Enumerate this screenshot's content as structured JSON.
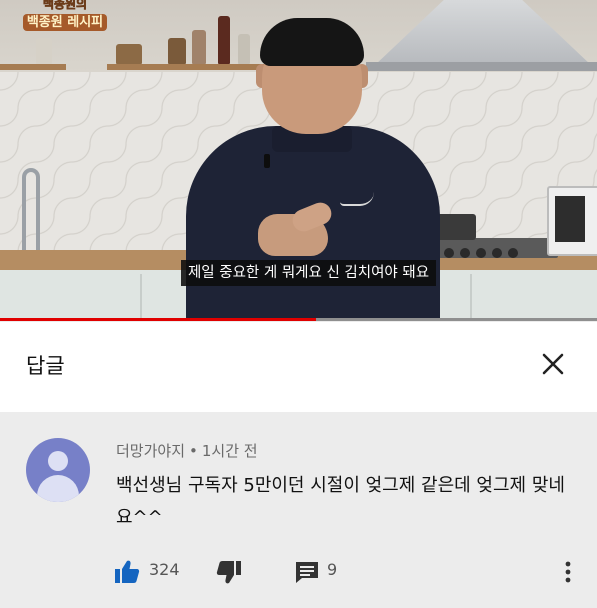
{
  "video": {
    "channel_logo_line1": "백종원의",
    "channel_logo_line2": "백종원 레시피",
    "subtitle": "제일 중요한 게 뭐게요 신 김치여야 돼요",
    "progress_fraction": 0.53
  },
  "replies_panel": {
    "title": "답글",
    "close_icon": "close-icon"
  },
  "comment": {
    "author": "더망가야지",
    "separator": "•",
    "time": "1시간 전",
    "text": "백선생님 구독자 5만이던 시절이 엊그제 같은데 엊그제 맞네요^^",
    "likes": "324",
    "replies": "9"
  },
  "colors": {
    "like_blue": "#1565c0",
    "progress_red": "#e00000",
    "avatar_purple": "#7780c8"
  }
}
